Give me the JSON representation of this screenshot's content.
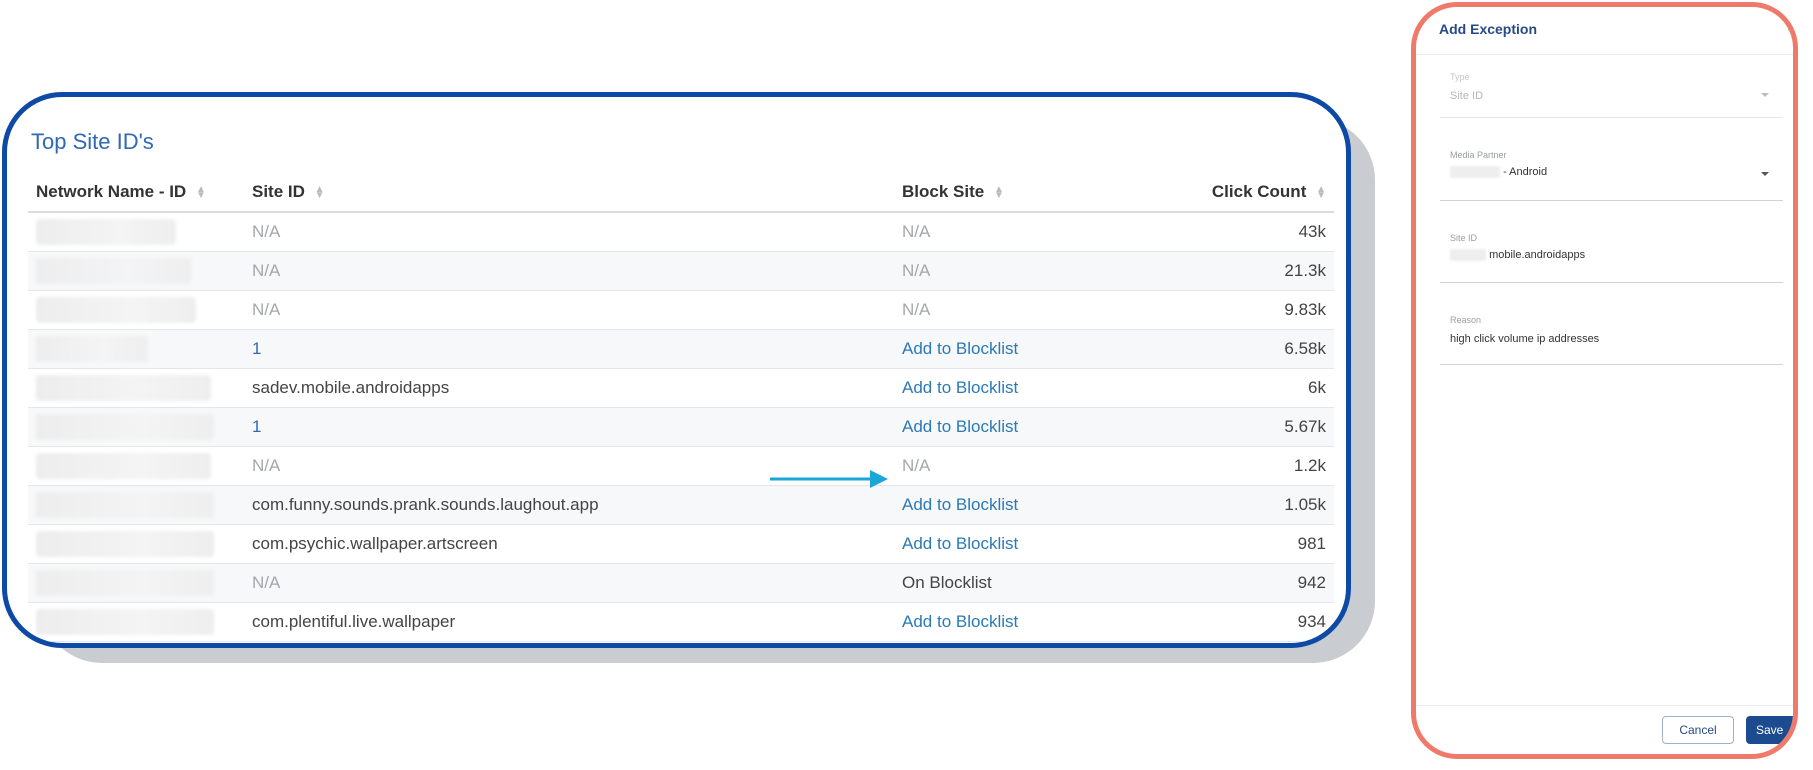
{
  "table_card": {
    "title": "Top Site ID's",
    "columns": [
      "Network Name - ID",
      "Site ID",
      "Block Site",
      "Click Count"
    ],
    "rows": [
      {
        "site_id": "N/A",
        "block": "N/A",
        "count": "43k"
      },
      {
        "site_id": "N/A",
        "block": "N/A",
        "count": "21.3k"
      },
      {
        "site_id": "N/A",
        "block": "N/A",
        "count": "9.83k"
      },
      {
        "site_id": "1",
        "block": "Add to Blocklist",
        "count": "6.58k"
      },
      {
        "site_id": "sadev.mobile.androidapps",
        "block": "Add to Blocklist",
        "count": "6k"
      },
      {
        "site_id": "1",
        "block": "Add to Blocklist",
        "count": "5.67k"
      },
      {
        "site_id": "N/A",
        "block": "N/A",
        "count": "1.2k"
      },
      {
        "site_id": "com.funny.sounds.prank.sounds.laughout.app",
        "block": "Add to Blocklist",
        "count": "1.05k"
      },
      {
        "site_id": "com.psychic.wallpaper.artscreen",
        "block": "Add to Blocklist",
        "count": "981"
      },
      {
        "site_id": "N/A",
        "block": "On Blocklist",
        "count": "942"
      },
      {
        "site_id": "com.plentiful.live.wallpaper",
        "block": "Add to Blocklist",
        "count": "934"
      }
    ]
  },
  "modal": {
    "title": "Add Exception",
    "close": "×",
    "fields": {
      "type": {
        "label": "Type",
        "value": "Site ID"
      },
      "media_partner": {
        "label": "Media Partner",
        "value": "- Android"
      },
      "site_id": {
        "label": "Site ID",
        "value": "mobile.androidapps"
      },
      "reason": {
        "label": "Reason",
        "value": "high click volume ip addresses"
      }
    },
    "cancel_label": "Cancel",
    "save_label": "Save"
  },
  "colors": {
    "card_border": "#0d4aa6",
    "modal_border": "#f07a6a",
    "link": "#2b79b5",
    "arrow": "#1ba6d8",
    "save_button": "#1d4b8f"
  }
}
